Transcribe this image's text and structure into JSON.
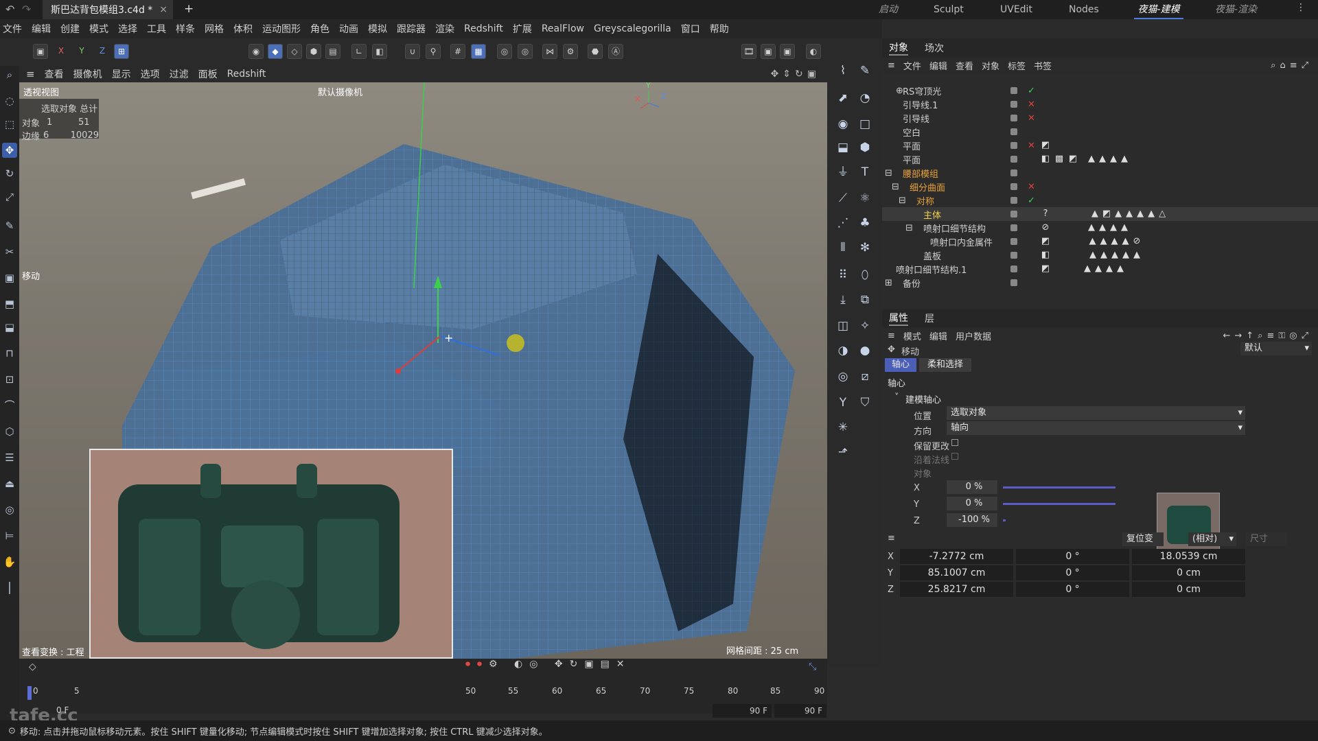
{
  "titlebar": {
    "doc_tab": "斯巴达背包模组3.c4d *",
    "close": "×",
    "add": "+",
    "modes": [
      "启动",
      "Sculpt",
      "UVEdit",
      "Nodes",
      "夜猫-建模",
      "夜猫-渲染"
    ]
  },
  "menu": [
    "文件",
    "编辑",
    "创建",
    "模式",
    "选择",
    "工具",
    "样条",
    "网格",
    "体积",
    "运动图形",
    "角色",
    "动画",
    "模拟",
    "跟踪器",
    "渲染",
    "Redshift",
    "扩展",
    "RealFlow",
    "Greyscalegorilla",
    "窗口",
    "帮助"
  ],
  "toolbar": {
    "axes": [
      "X",
      "Y",
      "Z"
    ]
  },
  "viewport_menu": [
    "查看",
    "摄像机",
    "显示",
    "选项",
    "过滤",
    "面板",
    "Redshift"
  ],
  "viewport": {
    "name": "透视视图",
    "camera": "默认摄像机",
    "hud_header": "选取对象 总计",
    "hud_rows": [
      {
        "label": "对象",
        "sel": "1",
        "total": "51"
      },
      {
        "label": "边缘",
        "sel": "6",
        "total": "10029"
      }
    ],
    "tool_label": "移动",
    "grid_spacing": "网格间距 : 25 cm",
    "view_transform": "查看变换 : 工程",
    "axis_y": "Y",
    "axis_x": "X",
    "axis_z": "Z"
  },
  "objects_panel": {
    "tabs": [
      "对象",
      "场次"
    ],
    "menu": [
      "文件",
      "编辑",
      "查看",
      "对象",
      "标签",
      "书签"
    ],
    "items": [
      {
        "name": "RS穹顶光",
        "flag": "✓",
        "flag_color": "#3cd65a"
      },
      {
        "name": "引导线.1",
        "flag": "✕",
        "flag_color": "#e04040"
      },
      {
        "name": "引导线",
        "flag": "✕",
        "flag_color": "#e04040"
      },
      {
        "name": "空白",
        "flag": ""
      },
      {
        "name": "平面",
        "flag": "✕",
        "flag_color": "#e04040"
      },
      {
        "name": "平面",
        "flag": ""
      },
      {
        "name": "腰部模组",
        "flag": "",
        "color": "#e8a23a"
      },
      {
        "name": "细分曲面",
        "flag": "✕",
        "flag_color": "#e04040",
        "color": "#e8a23a"
      },
      {
        "name": "对称",
        "flag": "✓",
        "flag_color": "#3cd65a",
        "color": "#e8a23a"
      },
      {
        "name": "主体",
        "flag": "",
        "color": "#f2d34a"
      },
      {
        "name": "喷射口细节结构",
        "flag": ""
      },
      {
        "name": "喷射口内金属件",
        "flag": ""
      },
      {
        "name": "盖板",
        "flag": ""
      },
      {
        "name": "喷射口细节结构.1",
        "flag": ""
      },
      {
        "name": "备份",
        "flag": ""
      }
    ]
  },
  "attributes": {
    "tabs": [
      "属性",
      "层"
    ],
    "menu": [
      "模式",
      "编辑",
      "用户数据"
    ],
    "tool": "移动",
    "preset": "默认",
    "subtabs": [
      "轴心",
      "柔和选择"
    ],
    "section": "轴心",
    "group": "建模轴心",
    "position_label": "位置",
    "position_value": "选取对象",
    "orientation_label": "方向",
    "orientation_value": "轴向",
    "keep_changes": "保留更改",
    "along_normal": "沿着法线",
    "object_label": "对象",
    "axes": [
      {
        "axis": "X",
        "value": "0 %",
        "fraction": 0.5
      },
      {
        "axis": "Y",
        "value": "0 %",
        "fraction": 0.5
      },
      {
        "axis": "Z",
        "value": "-100 %",
        "fraction": 0.0
      }
    ]
  },
  "coords": {
    "reset_label": "复位变",
    "size_label": "尺寸",
    "mode_label": "(相对)",
    "rows": [
      {
        "axis": "X",
        "pos": "-7.2772 cm",
        "rot": "0 °",
        "size": "18.0539 cm"
      },
      {
        "axis": "Y",
        "pos": "85.1007 cm",
        "rot": "0 °",
        "size": "0 cm"
      },
      {
        "axis": "Z",
        "pos": "25.8217 cm",
        "rot": "0 °",
        "size": "0 cm"
      }
    ]
  },
  "timeline": {
    "left_ticks": [
      "0",
      "5"
    ],
    "right_ticks": [
      "50",
      "55",
      "60",
      "65",
      "70",
      "75",
      "80",
      "85",
      "90"
    ],
    "current_frame": "0 F",
    "end1": "90 F",
    "end2": "90 F"
  },
  "status": "移动: 点击并拖动鼠标移动元素。按住 SHIFT 键量化移动; 节点编辑模式时按住 SHIFT 键增加选择对象; 按住 CTRL 键减少选择对象。",
  "watermark": "tafe.cc"
}
